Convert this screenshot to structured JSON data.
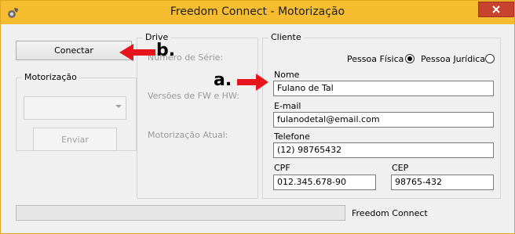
{
  "window": {
    "title": "Freedom Connect - Motorização"
  },
  "connect_button": {
    "label": "Conectar"
  },
  "motorizacao": {
    "group_title": "Motorização",
    "combo_value": "",
    "send_label": "Enviar"
  },
  "drive": {
    "group_title": "Drive",
    "serial_label": "Número de Série:",
    "fw_hw_label": "Versões de FW e HW:",
    "current_label": "Motorização Atual:"
  },
  "cliente": {
    "group_title": "Cliente",
    "radio_fisica": "Pessoa Física",
    "radio_juridica": "Pessoa Jurídica",
    "selected": "Pessoa Física",
    "nome_label": "Nome",
    "nome_value": "Fulano de Tal",
    "email_label": "E-mail",
    "email_value": "fulanodetal@email.com",
    "telefone_label": "Telefone",
    "telefone_value": "(12) 98765432",
    "cpf_label": "CPF",
    "cpf_value": "012.345.678-90",
    "cep_label": "CEP",
    "cep_value": "98765-432"
  },
  "status": {
    "text": "Freedom Connect",
    "progress": 0
  },
  "annotations": {
    "a": "a.",
    "b": "b."
  },
  "colors": {
    "titlebar": "#f7bd30",
    "close": "#c7432d",
    "annotation_arrow": "#e8141c"
  }
}
